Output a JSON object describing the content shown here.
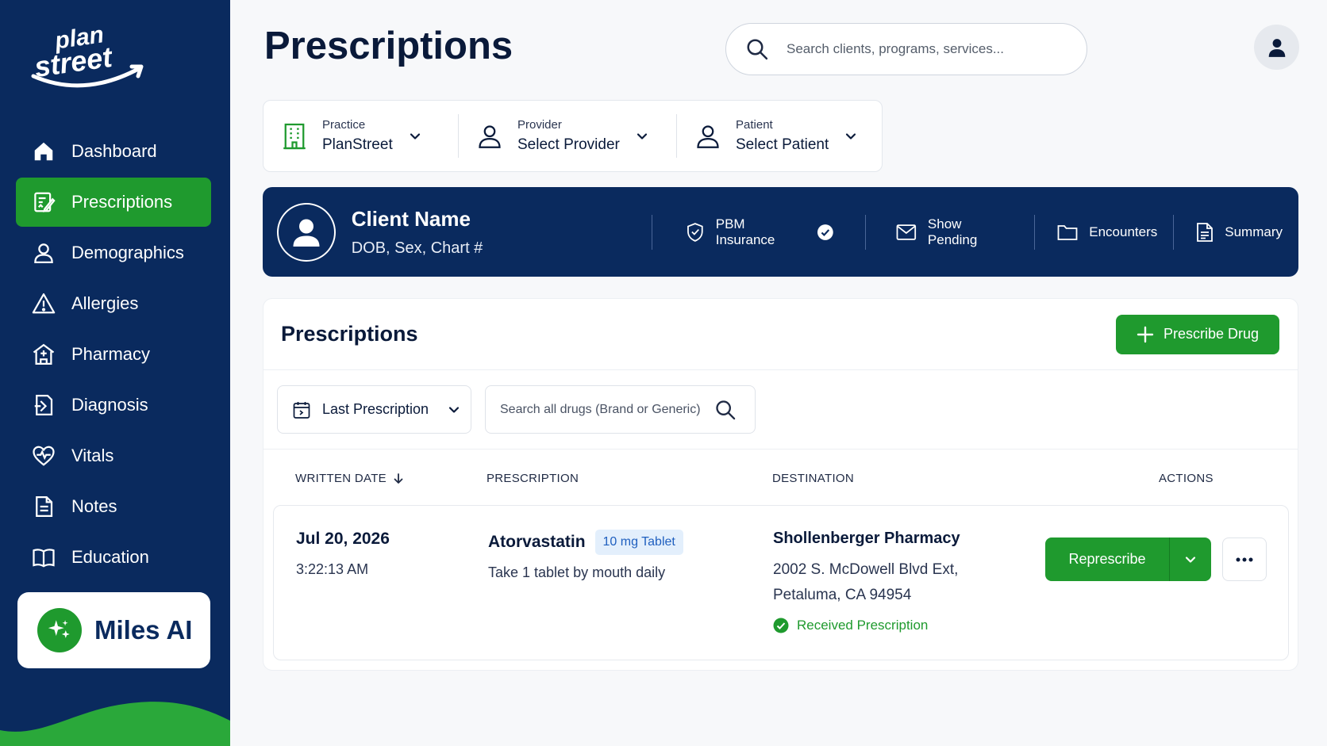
{
  "app": {
    "logo_text": "plan street"
  },
  "sidebar": {
    "items": [
      {
        "label": "Dashboard",
        "icon": "home-icon",
        "active": false
      },
      {
        "label": "Prescriptions",
        "icon": "prescription-icon",
        "active": true
      },
      {
        "label": "Demographics",
        "icon": "person-icon",
        "active": false
      },
      {
        "label": "Allergies",
        "icon": "warning-icon",
        "active": false
      },
      {
        "label": "Pharmacy",
        "icon": "pharmacy-icon",
        "active": false
      },
      {
        "label": "Diagnosis",
        "icon": "diagnosis-icon",
        "active": false
      },
      {
        "label": "Vitals",
        "icon": "heart-pulse-icon",
        "active": false
      },
      {
        "label": "Notes",
        "icon": "document-icon",
        "active": false
      },
      {
        "label": "Education",
        "icon": "book-icon",
        "active": false
      }
    ],
    "miles_label": "Miles AI"
  },
  "header": {
    "title": "Prescriptions",
    "search_placeholder": "Search clients, programs, services..."
  },
  "selectors": {
    "practice": {
      "label": "Practice",
      "value": "PlanStreet"
    },
    "provider": {
      "label": "Provider",
      "value": "Select Provider"
    },
    "patient": {
      "label": "Patient",
      "value": "Select Patient"
    }
  },
  "client": {
    "name": "Client Name",
    "details": "DOB, Sex, Chart #",
    "actions": {
      "pbm": "PBM Insurance",
      "pending": "Show Pending",
      "encounters": "Encounters",
      "summary": "Summary"
    }
  },
  "prescriptions": {
    "title": "Prescriptions",
    "prescribe_label": "Prescribe Drug",
    "filter_label": "Last Prescription",
    "drug_search_placeholder": "Search all drugs (Brand or Generic)",
    "columns": {
      "written_date": "WRITTEN DATE",
      "prescription": "PRESCRIPTION",
      "destination": "DESTINATION",
      "actions": "ACTIONS"
    },
    "rows": [
      {
        "date": "Jul 20, 2026",
        "time": "3:22:13 AM",
        "drug": "Atorvastatin",
        "dose": "10 mg Tablet",
        "sig": "Take 1 tablet by mouth daily",
        "pharmacy": "Shollenberger Pharmacy",
        "address_line1": "2002 S. McDowell Blvd Ext,",
        "address_line2": "Petaluma, CA 94954",
        "status": "Received Prescription",
        "represcribe_label": "Represcribe"
      }
    ]
  },
  "colors": {
    "navy": "#0a2a5e",
    "green": "#1f9a2e",
    "badge_bg": "#e3effc",
    "badge_text": "#1f5fbf"
  }
}
